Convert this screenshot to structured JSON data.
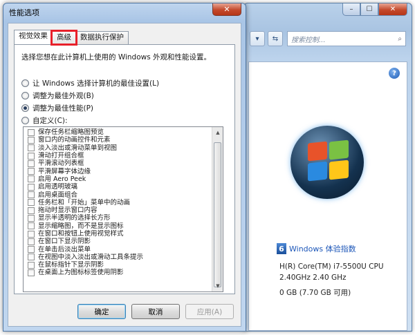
{
  "system_window": {
    "search_placeholder": "搜索控制...",
    "help_glyph": "?",
    "wei_badge": "6",
    "wei_link": "Windows 体验指数",
    "specs": [
      "H(R) Core(TM) i7-5500U CPU",
      "2.40GHz   2.40 GHz",
      "0 GB (7.70 GB 可用)"
    ]
  },
  "dialog": {
    "title": "性能选项",
    "close_glyph": "✕",
    "tabs": [
      {
        "label": "视觉效果",
        "active": true
      },
      {
        "label": "高级",
        "active": false,
        "highlighted": true
      },
      {
        "label": "数据执行保护",
        "active": false
      }
    ],
    "description": "选择您想在此计算机上使用的 Windows 外观和性能设置。",
    "radios": [
      {
        "label": "让 Windows 选择计算机的最佳设置(L)",
        "checked": false
      },
      {
        "label": "调整为最佳外观(B)",
        "checked": false
      },
      {
        "label": "调整为最佳性能(P)",
        "checked": true
      },
      {
        "label": "自定义(C):",
        "checked": false
      }
    ],
    "options": [
      "保存任务栏缩略图预览",
      "窗口内的动画控件和元素",
      "淡入淡出或滑动菜单到视图",
      "滑动打开组合框",
      "平滑滚动列表框",
      "平滑屏幕字体边缘",
      "启用 Aero Peek",
      "启用透明玻璃",
      "启用桌面组合",
      "任务栏和「开始」菜单中的动画",
      "拖动时显示窗口内容",
      "显示半透明的选择长方形",
      "显示缩略图，而不是显示图标",
      "在窗口和按钮上使用视觉样式",
      "在窗口下显示阴影",
      "在单击后淡出菜单",
      "在视图中淡入淡出或滑动工具条提示",
      "在鼠标指针下显示阴影",
      "在桌面上为图标标签使用阴影"
    ],
    "buttons": {
      "ok": "确定",
      "cancel": "取消",
      "apply": "应用(A)"
    }
  },
  "colors": {
    "highlight_box": "#e8202a",
    "title_bar": "#a9c5e6"
  }
}
